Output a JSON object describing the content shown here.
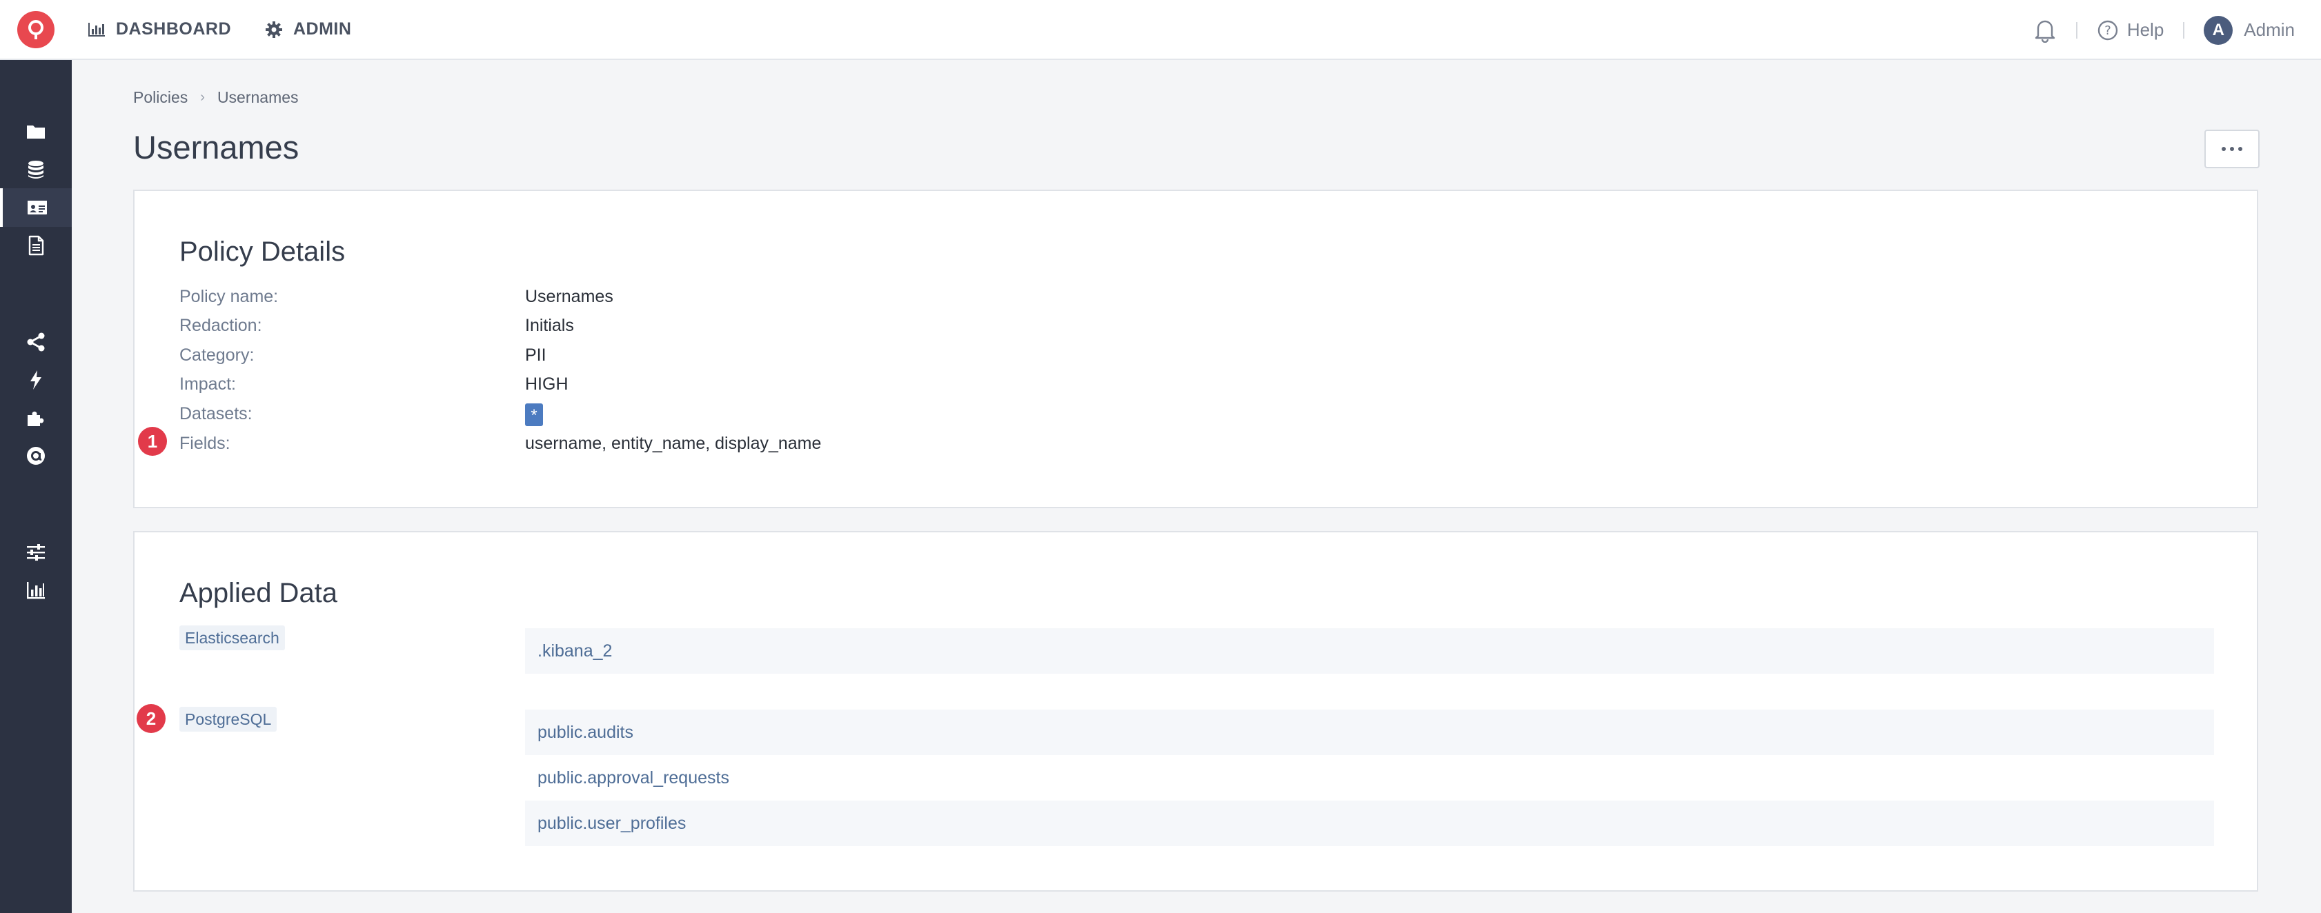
{
  "topbar": {
    "nav": [
      {
        "label": "DASHBOARD",
        "icon": "bar-chart-icon"
      },
      {
        "label": "ADMIN",
        "icon": "gear-icon"
      }
    ],
    "help_label": "Help",
    "user": {
      "initial": "A",
      "name": "Admin"
    }
  },
  "sidebar": {
    "items": [
      {
        "icon": "folder-icon",
        "active": false
      },
      {
        "icon": "database-icon",
        "active": false
      },
      {
        "icon": "id-card-icon",
        "active": true
      },
      {
        "icon": "document-icon",
        "active": false
      },
      {
        "icon": "share-icon",
        "active": false
      },
      {
        "icon": "bolt-icon",
        "active": false
      },
      {
        "icon": "puzzle-icon",
        "active": false
      },
      {
        "icon": "at-sign-icon",
        "active": false
      },
      {
        "icon": "sliders-icon",
        "active": false
      },
      {
        "icon": "bar-chart-icon",
        "active": false
      }
    ]
  },
  "breadcrumb": [
    "Policies",
    "Usernames"
  ],
  "page": {
    "title": "Usernames"
  },
  "policy_details": {
    "title": "Policy Details",
    "rows": [
      {
        "label": "Policy name:",
        "value": "Usernames"
      },
      {
        "label": "Redaction:",
        "value": "Initials"
      },
      {
        "label": "Category:",
        "value": "PII"
      },
      {
        "label": "Impact:",
        "value": "HIGH"
      },
      {
        "label": "Datasets:",
        "value": "*"
      },
      {
        "label": "Fields:",
        "value": "username, entity_name, display_name"
      }
    ]
  },
  "applied_data": {
    "title": "Applied Data",
    "sources": [
      {
        "name": "Elasticsearch",
        "items": [
          ".kibana_2"
        ]
      },
      {
        "name": "PostgreSQL",
        "items": [
          "public.audits",
          "public.approval_requests",
          "public.user_profiles"
        ]
      }
    ]
  },
  "markers": [
    "1",
    "2"
  ],
  "colors": {
    "accent": "#e8484f",
    "sidebar": "#2c3242",
    "link": "#4e6d96",
    "badge": "#4c7bc0"
  }
}
